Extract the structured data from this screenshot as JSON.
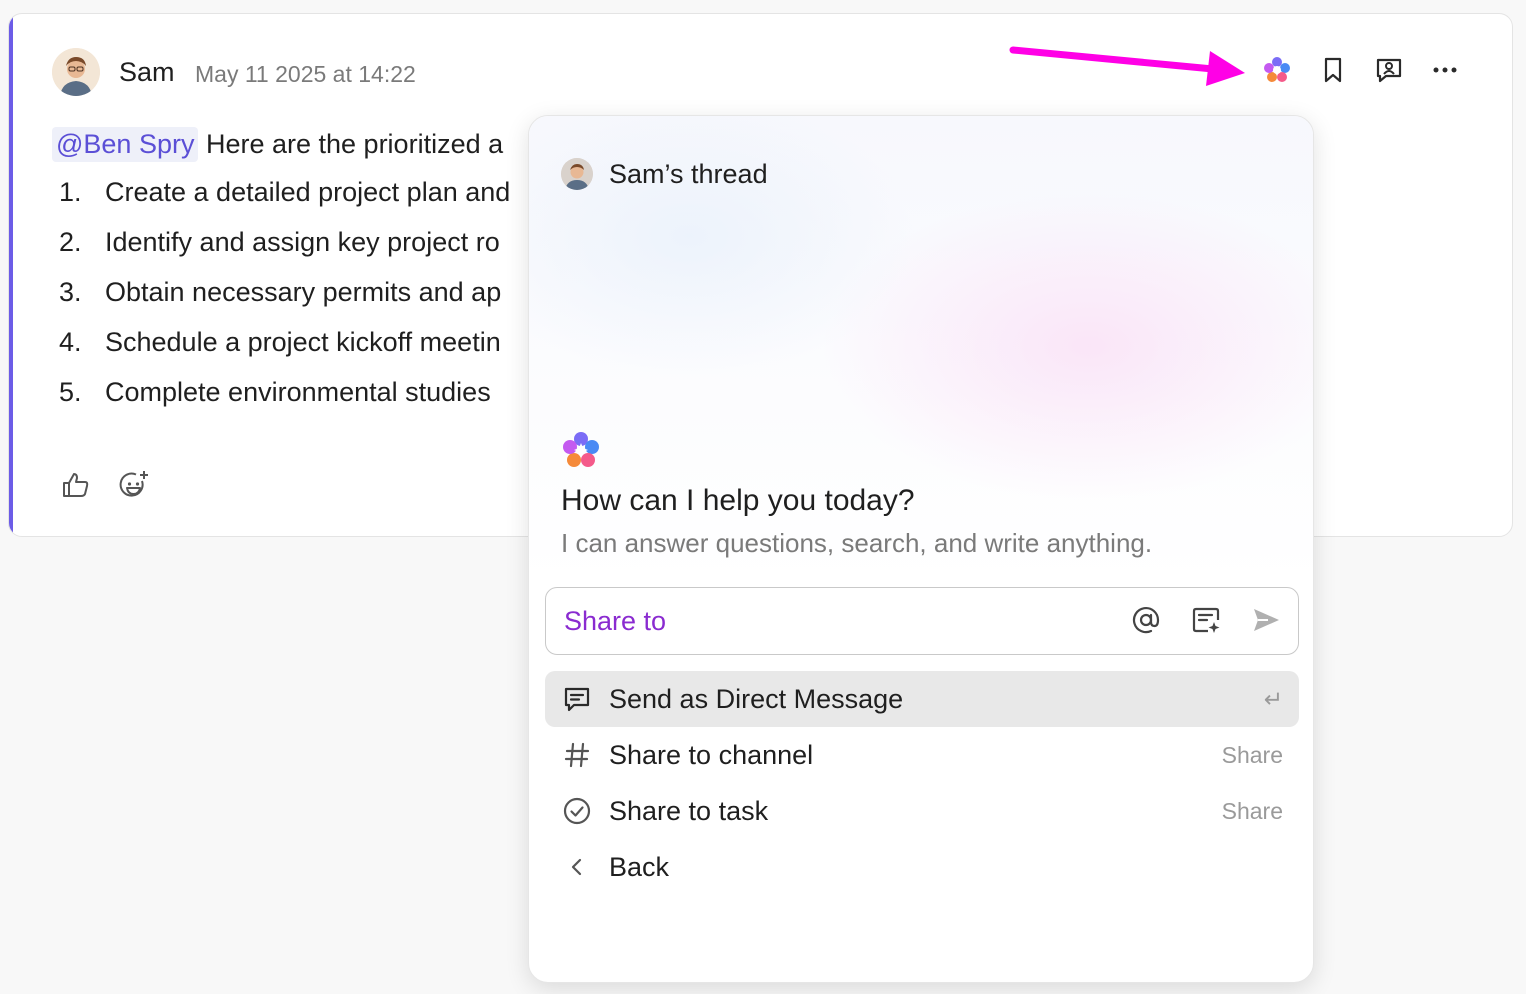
{
  "message": {
    "author": "Sam",
    "timestamp": "May 11 2025 at 14:22",
    "mention": "@Ben Spry",
    "intro_text": " Here are the prioritized a",
    "steps": [
      {
        "num": "1.",
        "text": "Create a detailed project plan and"
      },
      {
        "num": "2.",
        "text": "Identify and assign key project ro"
      },
      {
        "num": "3.",
        "text": "Obtain necessary permits and ap"
      },
      {
        "num": "4.",
        "text": "Schedule a project kickoff meetin"
      },
      {
        "num": "5.",
        "text": "Complete environmental studies"
      }
    ]
  },
  "toolbar": {
    "icons": [
      "ai-brain-icon",
      "bookmark-icon",
      "assign-comment-icon",
      "more-icon"
    ]
  },
  "popup": {
    "thread_title": "Sam’s thread",
    "help_title": "How can I help you today?",
    "help_subtitle": "I can answer questions, search, and write anything.",
    "share_placeholder": "Share to",
    "menu": [
      {
        "label": "Send as Direct Message",
        "hint": "↵",
        "icon": "direct-message-icon",
        "active": true
      },
      {
        "label": "Share to channel",
        "hint": "Share",
        "icon": "hash-icon",
        "active": false
      },
      {
        "label": "Share to task",
        "hint": "Share",
        "icon": "check-circle-icon",
        "active": false
      },
      {
        "label": "Back",
        "hint": "",
        "icon": "chevron-left-icon",
        "active": false
      }
    ]
  },
  "colors": {
    "accent_bar": "#6c5ce7",
    "mention_text": "#5b4fd6",
    "annotation_arrow": "#ff00e6",
    "share_text": "#8a2bd0"
  }
}
